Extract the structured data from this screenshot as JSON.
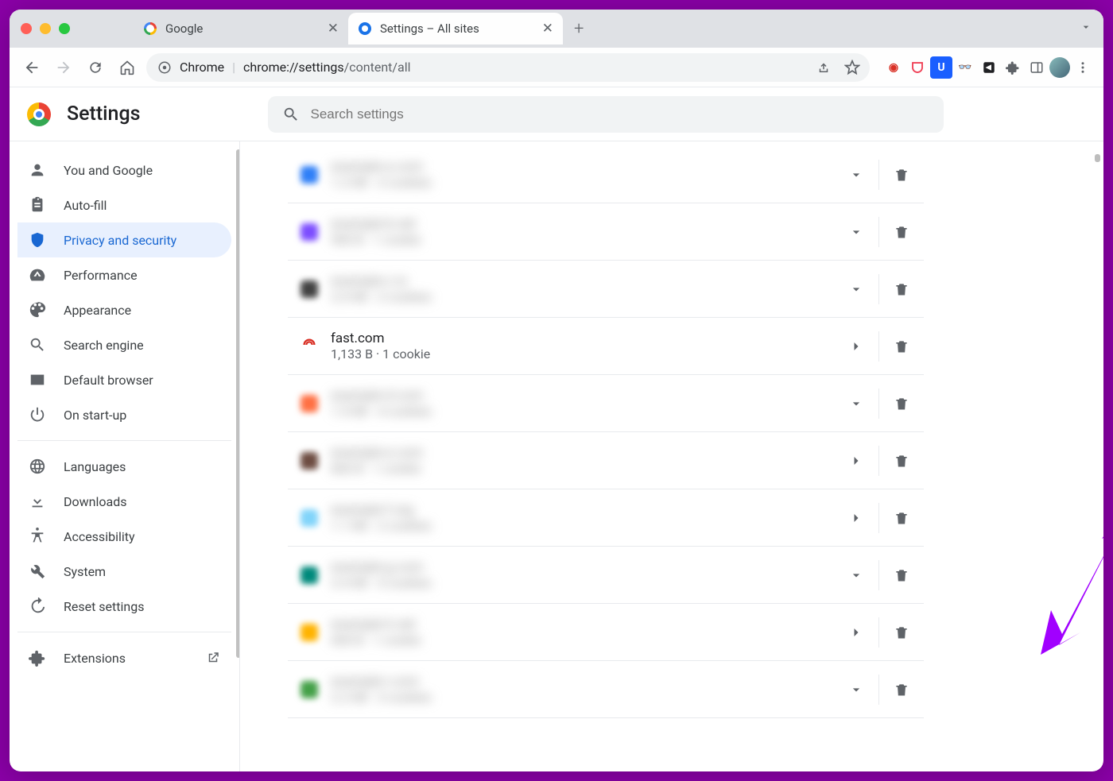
{
  "tabs": [
    {
      "label": "Google",
      "favicon": "google"
    },
    {
      "label": "Settings – All sites",
      "favicon": "gear",
      "active": true
    }
  ],
  "omnibox": {
    "scheme_label": "Chrome",
    "origin": "chrome://settings",
    "path": "/content/all"
  },
  "settings": {
    "title": "Settings",
    "search_placeholder": "Search settings"
  },
  "sidebar": {
    "items": [
      {
        "icon": "person",
        "label": "You and Google"
      },
      {
        "icon": "clipboard",
        "label": "Auto-fill"
      },
      {
        "icon": "shield",
        "label": "Privacy and security",
        "active": true
      },
      {
        "icon": "speed",
        "label": "Performance"
      },
      {
        "icon": "palette",
        "label": "Appearance"
      },
      {
        "icon": "search",
        "label": "Search engine"
      },
      {
        "icon": "browser",
        "label": "Default browser"
      },
      {
        "icon": "power",
        "label": "On start-up"
      }
    ],
    "secondary": [
      {
        "icon": "globe",
        "label": "Languages"
      },
      {
        "icon": "download",
        "label": "Downloads"
      },
      {
        "icon": "accessibility",
        "label": "Accessibility"
      },
      {
        "icon": "wrench",
        "label": "System"
      },
      {
        "icon": "restore",
        "label": "Reset settings"
      }
    ],
    "extensions_label": "Extensions"
  },
  "sites": [
    {
      "color": "#2f7ff7",
      "domain": "example-a.com",
      "meta": "1.2 KB · 3 cookies",
      "arrow": "chevron",
      "blurred": true
    },
    {
      "color": "#7c4dff",
      "domain": "example-b.net",
      "meta": "900 B · 1 cookie",
      "arrow": "chevron",
      "blurred": true
    },
    {
      "color": "#424242",
      "domain": "example-c.io",
      "meta": "2.0 KB · 2 cookies",
      "arrow": "chevron",
      "blurred": true
    },
    {
      "color": "#d93025",
      "domain": "fast.com",
      "meta": "1,133 B · 1 cookie",
      "arrow": "caret",
      "blurred": false,
      "favicon": "radio"
    },
    {
      "color": "#ff7043",
      "domain": "example-d.com",
      "meta": "1.5 KB · 4 cookies",
      "arrow": "chevron",
      "blurred": true
    },
    {
      "color": "#6d4c41",
      "domain": "example-e.com",
      "meta": "800 B · 1 cookie",
      "arrow": "caret",
      "blurred": true
    },
    {
      "color": "#81d4fa",
      "domain": "example-f.org",
      "meta": "1.1 KB · 2 cookies",
      "arrow": "caret",
      "blurred": true
    },
    {
      "color": "#00897b",
      "domain": "example-g.com",
      "meta": "3.4 KB · 5 cookies",
      "arrow": "chevron",
      "blurred": true
    },
    {
      "color": "#ffb300",
      "domain": "example-h.net",
      "meta": "600 B · 1 cookie",
      "arrow": "caret",
      "blurred": true
    },
    {
      "color": "#43a047",
      "domain": "example-i.com",
      "meta": "2.2 KB · 3 cookies",
      "arrow": "chevron",
      "blurred": true
    }
  ],
  "annotation": {
    "arrow_color": "#a100ff"
  }
}
